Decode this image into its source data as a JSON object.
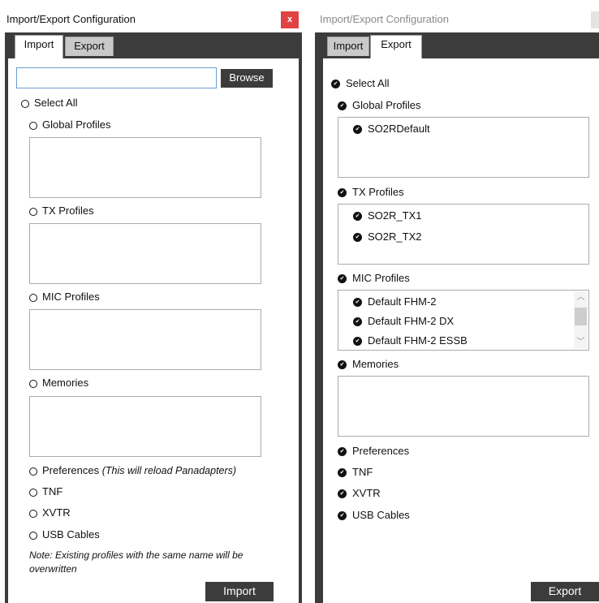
{
  "import_window": {
    "title": "Import/Export Configuration",
    "close_label": "x",
    "tabs": [
      "Import",
      "Export"
    ],
    "path_value": "",
    "browse_label": "Browse",
    "select_all": "Select All",
    "sections": {
      "global_profiles": "Global Profiles",
      "tx_profiles": "TX Profiles",
      "mic_profiles": "MIC Profiles",
      "memories": "Memories"
    },
    "options": {
      "preferences": "Preferences",
      "preferences_note": "(This will reload Panadapters)",
      "tnf": "TNF",
      "xvtr": "XVTR",
      "usb_cables": "USB Cables"
    },
    "note": "Note:  Existing profiles with the same name will be overwritten",
    "import_label": "Import"
  },
  "export_window": {
    "title": "Import/Export Configuration",
    "tabs": [
      "Import",
      "Export"
    ],
    "select_all": "Select All",
    "sections": {
      "global_profiles": "Global Profiles",
      "tx_profiles": "TX Profiles",
      "mic_profiles": "MIC Profiles",
      "memories": "Memories"
    },
    "global_profile_items": [
      "SO2RDefault"
    ],
    "tx_profile_items": [
      "SO2R_TX1",
      "SO2R_TX2"
    ],
    "mic_profile_items": [
      "Default FHM-2",
      "Default FHM-2 DX",
      "Default FHM-2 ESSB"
    ],
    "options": {
      "preferences": "Preferences",
      "tnf": "TNF",
      "xvtr": "XVTR",
      "usb_cables": "USB Cables"
    },
    "export_label": "Export"
  }
}
